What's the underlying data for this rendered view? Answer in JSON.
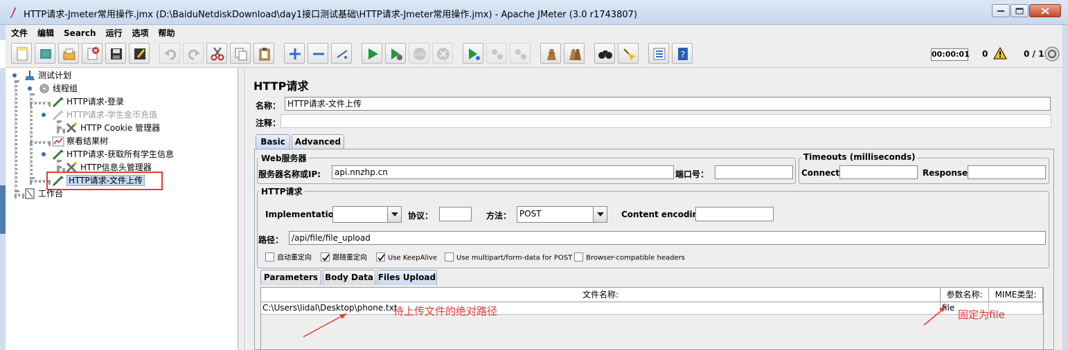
{
  "window": {
    "title": "HTTP请求-Jmeter常用操作.jmx (D:\\BaiduNetdiskDownload\\day1接口测试基础\\HTTP请求-Jmeter常用操作.jmx) - Apache JMeter (3.0 r1743807)",
    "controls": [
      "minimize-icon",
      "maximize-icon",
      "close-icon"
    ]
  },
  "menu": [
    "文件",
    "编辑",
    "Search",
    "运行",
    "选项",
    "帮助"
  ],
  "toolbar": {
    "icons": [
      "new-icon",
      "templates-icon",
      "open-icon",
      "close-file-icon",
      "save-icon",
      "save-as-icon",
      "undo-icon",
      "redo-icon",
      "cut-icon",
      "copy-icon",
      "paste-icon",
      "expand-icon",
      "collapse-icon",
      "toggle-icon",
      "start-icon",
      "start-no-pause-icon",
      "stop-icon",
      "shutdown-icon",
      "remote-start-icon",
      "remote-stop-icon",
      "remote-shutdown-icon",
      "clear-icon",
      "clear-all-icon",
      "search-icon",
      "reset-search-icon",
      "function-helper-icon",
      "help-icon"
    ],
    "timer": "00:00:01",
    "error_count": "0",
    "thread_count": "0 / 1",
    "warning_color": "#f5c400"
  },
  "tree": {
    "nodes": [
      {
        "label": "测试计划",
        "icon": "test-plan-icon",
        "enabled": true
      },
      {
        "label": "线程组",
        "icon": "thread-group-icon",
        "enabled": true
      },
      {
        "label": "HTTP请求-登录",
        "icon": "sampler-pen-icon",
        "enabled": true
      },
      {
        "label": "HTTP请求-学生金币充值",
        "icon": "sampler-pen-icon",
        "enabled": false
      },
      {
        "label": "HTTP Cookie 管理器",
        "icon": "config-tools-icon",
        "enabled": true
      },
      {
        "label": "察看结果树",
        "icon": "listener-chart-icon",
        "enabled": true
      },
      {
        "label": "HTTP请求-获取所有学生信息",
        "icon": "sampler-pen-icon",
        "enabled": true
      },
      {
        "label": "HTTP信息头管理器",
        "icon": "config-tools-icon",
        "enabled": true
      },
      {
        "label": "HTTP请求-文件上传",
        "icon": "sampler-pen-icon",
        "enabled": true,
        "selected": true
      },
      {
        "label": "工作台",
        "icon": "workbench-icon",
        "enabled": true
      }
    ]
  },
  "form": {
    "heading": "HTTP请求",
    "name_label": "名称：",
    "name_value": "HTTP请求-文件上传",
    "comment_label": "注释：",
    "comment_value": "",
    "tabs": [
      "Basic",
      "Advanced"
    ],
    "active_tab": "Basic",
    "web_server": {
      "title": "Web服务器",
      "server_label": "服务器名称或IP:",
      "server_value": "api.nnzhp.cn",
      "port_label": "端口号：",
      "port_value": ""
    },
    "timeouts": {
      "title": "Timeouts (milliseconds)",
      "connect_label": "Connect:",
      "connect_value": "",
      "response_label": "Response:",
      "response_value": ""
    },
    "http_request": {
      "title": "HTTP请求",
      "impl_label": "Implementation:",
      "impl_value": "",
      "protocol_label": "协议：",
      "protocol_value": "",
      "method_label": "方法：",
      "method_value": "POST",
      "encoding_label": "Content encoding:",
      "encoding_value": "",
      "path_label": "路径：",
      "path_value": "/api/file/file_upload"
    },
    "options": [
      {
        "label": "自动重定向",
        "checked": false
      },
      {
        "label": "跟随重定向",
        "checked": true
      },
      {
        "label": "Use KeepAlive",
        "checked": true
      },
      {
        "label": "Use multipart/form-data for POST",
        "checked": false
      },
      {
        "label": "Browser-compatible headers",
        "checked": false
      }
    ],
    "sub_tabs": [
      "Parameters",
      "Body Data",
      "Files Upload"
    ],
    "active_sub_tab": "Files Upload",
    "files_table": {
      "columns": [
        "文件名称:",
        "参数名称:",
        "MIME类型:"
      ],
      "rows": [
        {
          "file": "C:\\Users\\lidal\\Desktop\\phone.txt",
          "param": "file",
          "mime": ""
        }
      ]
    }
  },
  "annotations": {
    "path_note": "待上传文件的绝对路径",
    "param_note": "固定为file",
    "color": "#e53935"
  }
}
